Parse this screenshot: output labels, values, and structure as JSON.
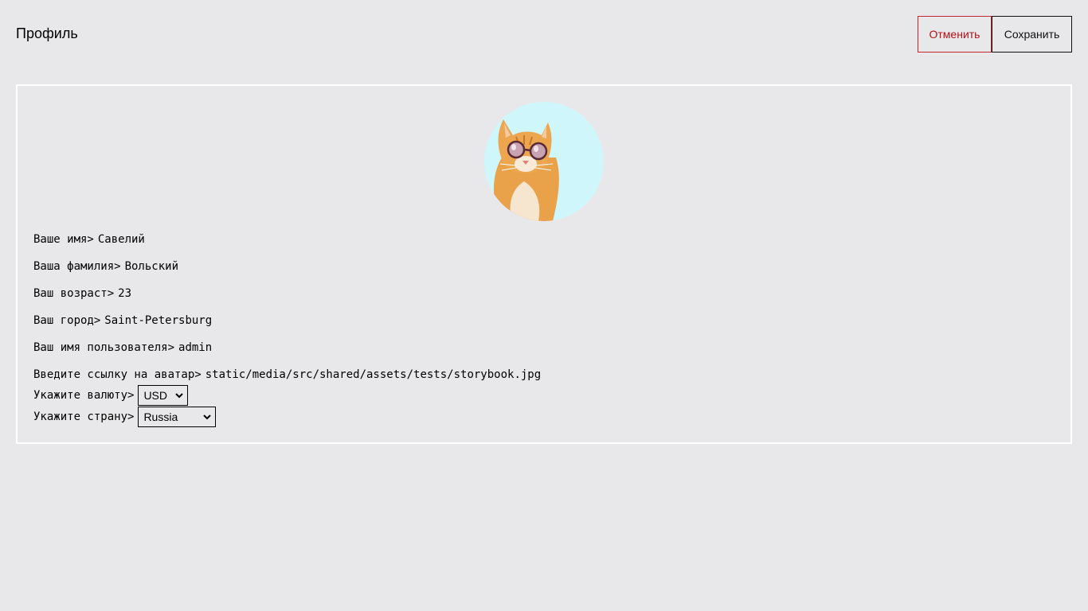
{
  "header": {
    "title": "Профиль",
    "cancel_label": "Отменить",
    "save_label": "Сохранить"
  },
  "colors": {
    "background": "#e8e7e9",
    "cancel": "#b01217",
    "avatar_bg": "#cff7fb",
    "card_border": "#ffffff"
  },
  "avatar": {
    "icon": "cat-with-sunglasses-avatar"
  },
  "fields": {
    "first_name": {
      "label": "Ваше имя>",
      "value": "Савелий"
    },
    "last_name": {
      "label": "Ваша фамилия>",
      "value": "Вольский"
    },
    "age": {
      "label": "Ваш возраст>",
      "value": "23"
    },
    "city": {
      "label": "Ваш город>",
      "value": "Saint-Petersburg"
    },
    "username": {
      "label": "Ваш имя пользователя>",
      "value": "admin"
    },
    "avatar_link": {
      "label": "Введите ссылку на аватар>",
      "value": "static/media/src/shared/assets/tests/storybook.jpg"
    }
  },
  "selects": {
    "currency": {
      "label": "Укажите валюту>",
      "value": "USD"
    },
    "country": {
      "label": "Укажите страну>",
      "value": "Russia"
    }
  }
}
